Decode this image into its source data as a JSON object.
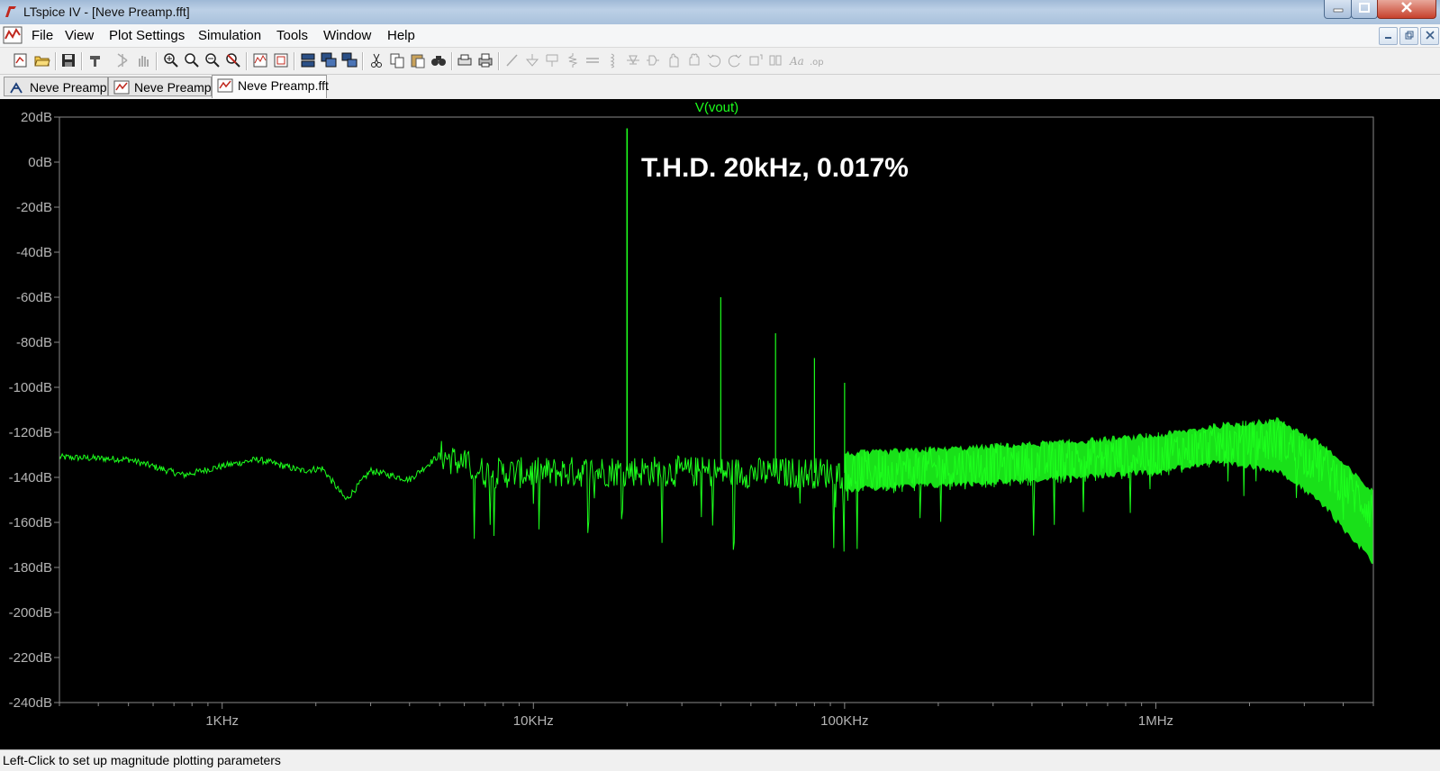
{
  "window": {
    "title": "LTspice IV - [Neve Preamp.fft]"
  },
  "menu": {
    "items": [
      "File",
      "View",
      "Plot Settings",
      "Simulation",
      "Tools",
      "Window",
      "Help"
    ]
  },
  "toolbar": {
    "icons": [
      "new-schematic-icon",
      "open-icon",
      "save-icon",
      "control-panel-icon",
      "run-icon",
      "halt-icon",
      "zoom-in-icon",
      "zoom-area-icon",
      "zoom-out-icon",
      "zoom-cancel-icon",
      "autorange-icon",
      "fit-icon",
      "tile-horizontal-icon",
      "cascade-icon",
      "tile-vertical-icon",
      "cut-icon",
      "copy-icon",
      "paste-icon",
      "find-icon",
      "print-preview-icon",
      "print-icon",
      "wire-icon",
      "ground-icon",
      "label-icon",
      "resistor-icon",
      "capacitor-icon",
      "inductor-icon",
      "diode-icon",
      "component-icon",
      "move-icon",
      "undo-icon",
      "redo-icon",
      "rotate-icon",
      "mirror-icon",
      "text-icon",
      "spice-directive-icon"
    ]
  },
  "tabs": [
    {
      "label": "Neve Preamp",
      "icon": "schematic-icon",
      "active": false
    },
    {
      "label": "Neve Preamp",
      "icon": "waveform-icon",
      "active": false
    },
    {
      "label": "Neve Preamp.fft",
      "icon": "waveform-icon",
      "active": true
    }
  ],
  "annotation": "T.H.D. 20kHz, 0.017%",
  "chart_data": {
    "type": "line",
    "title": "V(vout)",
    "xscale": "log",
    "xlim_hz": [
      300,
      5000000
    ],
    "ylim_db": [
      -240,
      20
    ],
    "ytick_step_db": 20,
    "ytick_labels": [
      "20dB",
      "0dB",
      "-20dB",
      "-40dB",
      "-60dB",
      "-80dB",
      "-100dB",
      "-120dB",
      "-140dB",
      "-160dB",
      "-180dB",
      "-200dB",
      "-220dB",
      "-240dB"
    ],
    "xtick_labels": [
      {
        "hz": 1000,
        "label": "1KHz"
      },
      {
        "hz": 10000,
        "label": "10KHz"
      },
      {
        "hz": 100000,
        "label": "100KHz"
      },
      {
        "hz": 1000000,
        "label": "1MHz"
      }
    ],
    "series_color": "#1cff1c",
    "series": [
      {
        "name": "V(vout)",
        "noise_floor": [
          {
            "x": 300,
            "y": -131
          },
          {
            "x": 500,
            "y": -132
          },
          {
            "x": 750,
            "y": -139
          },
          {
            "x": 1000,
            "y": -135
          },
          {
            "x": 1300,
            "y": -132
          },
          {
            "x": 1800,
            "y": -137
          },
          {
            "x": 2100,
            "y": -136
          },
          {
            "x": 2500,
            "y": -150
          },
          {
            "x": 3000,
            "y": -137
          },
          {
            "x": 4000,
            "y": -141
          },
          {
            "x": 5000,
            "y": -130
          },
          {
            "x": 7000,
            "y": -138
          },
          {
            "x": 10000,
            "y": -138
          },
          {
            "x": 20000,
            "y": -137
          },
          {
            "x": 50000,
            "y": -138
          },
          {
            "x": 100000,
            "y": -138
          },
          {
            "x": 200000,
            "y": -136
          },
          {
            "x": 500000,
            "y": -133
          },
          {
            "x": 1000000,
            "y": -130
          },
          {
            "x": 1500000,
            "y": -126
          },
          {
            "x": 2500000,
            "y": -123
          },
          {
            "x": 3500000,
            "y": -135
          },
          {
            "x": 5000000,
            "y": -155
          }
        ],
        "peaks": [
          {
            "x": 20000,
            "y": 15
          },
          {
            "x": 40000,
            "y": -60
          },
          {
            "x": 60000,
            "y": -76
          },
          {
            "x": 80000,
            "y": -87
          },
          {
            "x": 100000,
            "y": -98
          }
        ]
      }
    ]
  },
  "status": {
    "text": "Left-Click to set up magnitude plotting parameters"
  }
}
